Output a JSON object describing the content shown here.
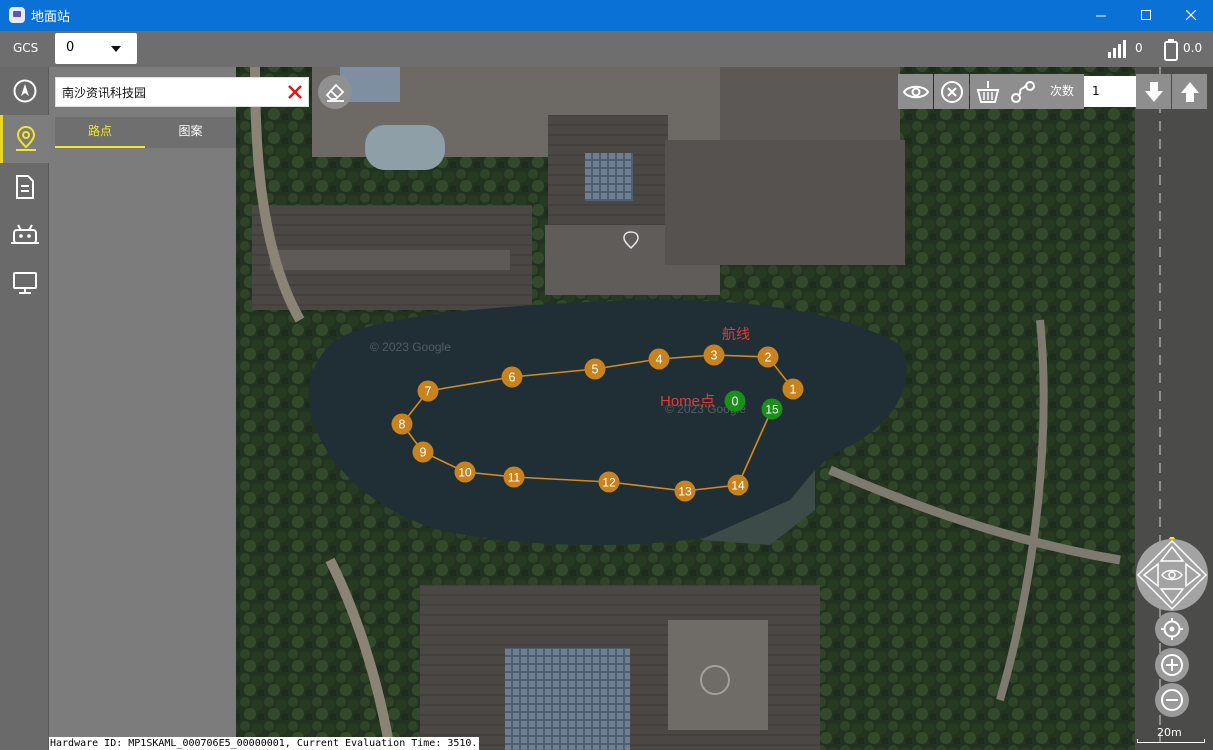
{
  "window": {
    "title": "地面站"
  },
  "toolbar": {
    "gcs_label": "GCS",
    "select_value": "0",
    "signal_value": "0",
    "battery_value": "0.0"
  },
  "nav": {
    "items": [
      {
        "icon": "compass-icon"
      },
      {
        "icon": "waypoint-map-pin-icon",
        "active": true
      },
      {
        "icon": "document-icon"
      },
      {
        "icon": "robot-icon"
      },
      {
        "icon": "monitor-icon"
      }
    ]
  },
  "sidepanel": {
    "search_value": "南沙资讯科技园",
    "tabs": [
      {
        "label": "路点",
        "active": true
      },
      {
        "label": "图案",
        "active": false
      }
    ]
  },
  "map_tools": {
    "count_label": "次数",
    "count_value": "1"
  },
  "map": {
    "route_label": "航线",
    "home_label": "Home点",
    "watermark": "© 2023 Google",
    "scale_label": "20m",
    "home": {
      "id": "0",
      "color": "#1a8f1a"
    },
    "waypoint_color": "#c8821e",
    "route_color": "#d68a1e",
    "waypoints": [
      {
        "id": "1"
      },
      {
        "id": "2"
      },
      {
        "id": "3"
      },
      {
        "id": "4"
      },
      {
        "id": "5"
      },
      {
        "id": "6"
      },
      {
        "id": "7"
      },
      {
        "id": "8"
      },
      {
        "id": "9"
      },
      {
        "id": "10"
      },
      {
        "id": "11"
      },
      {
        "id": "12"
      },
      {
        "id": "13"
      },
      {
        "id": "14"
      },
      {
        "id": "15",
        "color": "#1a8f1a"
      }
    ]
  },
  "footer": {
    "text": "Hardware ID: MP1SKAML_000706E5_00000001, Current Evaluation Time: 3510."
  }
}
